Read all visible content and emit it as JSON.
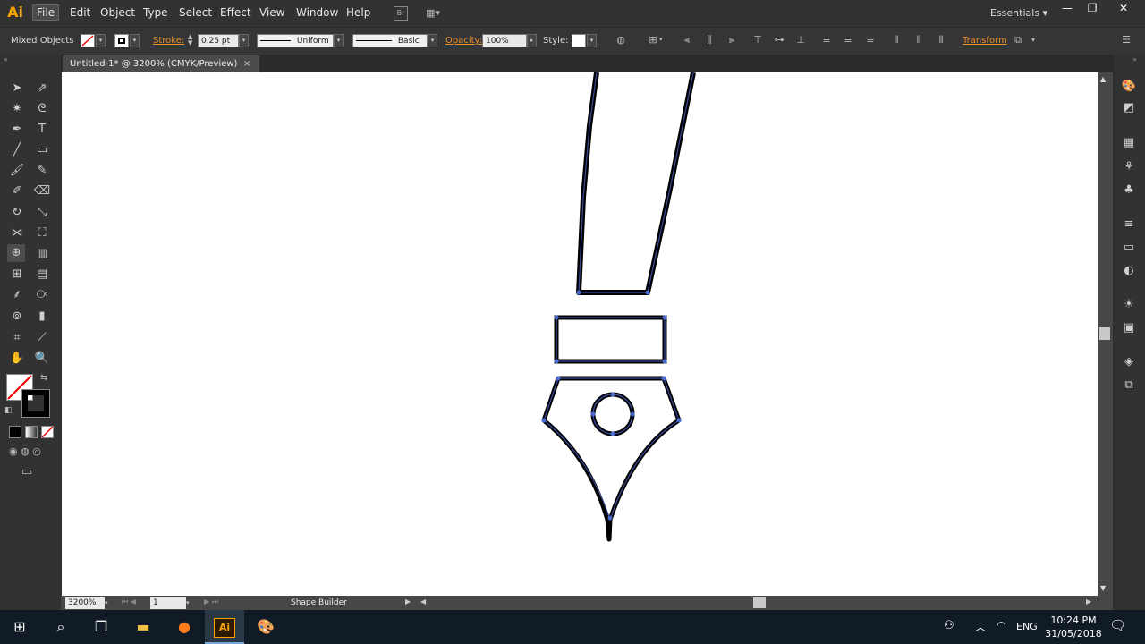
{
  "app": {
    "logo": "Ai",
    "menu": [
      "File",
      "Edit",
      "Object",
      "Type",
      "Select",
      "Effect",
      "View",
      "Window",
      "Help"
    ],
    "bridge_label": "Br",
    "workspace": "Essentials",
    "window_controls": [
      "minimize-icon",
      "restore-icon",
      "close-icon"
    ]
  },
  "control_bar": {
    "selection_type": "Mixed Objects",
    "stroke_label": "Stroke:",
    "stroke_weight": "0.25 pt",
    "profile": "Uniform",
    "brush": "Basic",
    "opacity_label": "Opacity:",
    "opacity_value": "100%",
    "style_label": "Style:",
    "transform_label": "Transform"
  },
  "document_tab": {
    "title": "Untitled-1* @ 3200% (CMYK/Preview)",
    "close": "×"
  },
  "status_bar": {
    "zoom": "3200%",
    "artboard": "1",
    "current_tool": "Shape Builder"
  },
  "taskbar": {
    "language": "ENG",
    "time": "10:24 PM",
    "date": "31/05/2018"
  },
  "colors": {
    "accent_orange": "#e8912d",
    "illustrator_brand": "#f7a400",
    "path_outline": "#2c3a8c",
    "stroke_black": "#000000",
    "canvas": "#ffffff"
  }
}
